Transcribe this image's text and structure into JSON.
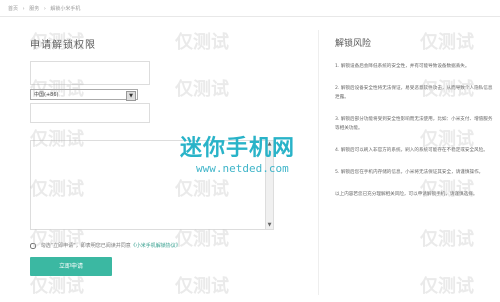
{
  "breadcrumb": [
    "首页",
    "服务",
    "解锁小米手机"
  ],
  "form": {
    "title": "申请解锁权限",
    "country_select": "中国(+86)",
    "agree_text": "勾选“立即申请”，即表明您已阅读并同意",
    "agree_link": "《小米手机解锁协议》",
    "submit_label": "立即申请"
  },
  "risk": {
    "title": "解锁风险",
    "items": [
      "1. 解锁设备后会降低系统的安全性，并有可能导致设备数据丢失。",
      "2. 解锁后设备安全性将无法保证，易受恶意软件攻击，从而导致个人隐私信息泄露。",
      "3. 解锁后部分功能将受到安全性影响而无法使用，比如：小米支付、增值服务等相关功能。",
      "4. 解锁后可以刷入非官方的系统，刷入的系统可能存在不稳定或安全风险。",
      "5. 解锁后您在手机内存储的信息，小米将无法保证其安全，请谨慎操作。"
    ],
    "footer": "以上内容若您已充分理解相关风险，可以申请解锁手机，请谨慎选择。"
  },
  "watermark": {
    "logo": "迷你手机网",
    "url": "www.netded.com",
    "repeat_text": "仅测试"
  },
  "colors": {
    "accent": "#3bb8a2",
    "logo": "#29b3c8"
  }
}
